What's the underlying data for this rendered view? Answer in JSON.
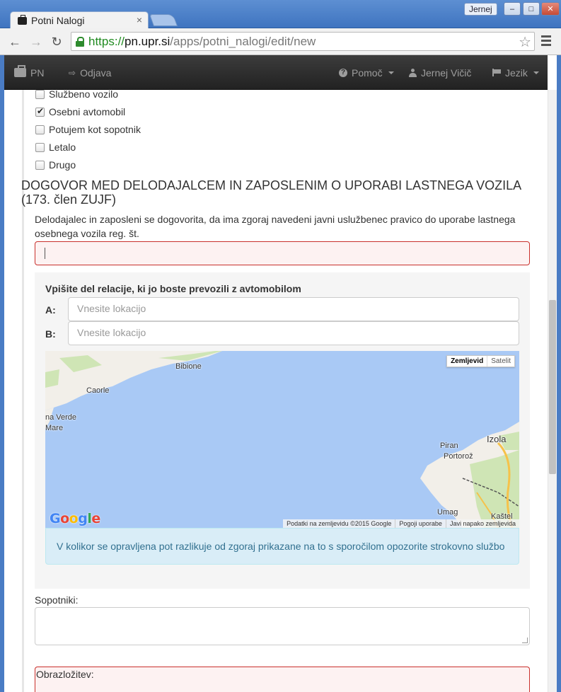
{
  "browser": {
    "tab_title": "Potni Nalogi",
    "tab_close": "×",
    "user_name": "Jernej",
    "url_scheme": "https://",
    "url_host": "pn.upr.si",
    "url_path": "/apps/potni_nalogi/edit/new"
  },
  "navbar": {
    "brand": "PN",
    "logout": "Odjava",
    "help": "Pomoč",
    "user": "Jernej Vičič",
    "language": "Jezik"
  },
  "transport_options": [
    {
      "label": "Službeno vozilo",
      "checked": false
    },
    {
      "label": "Osebni avtomobil",
      "checked": true
    },
    {
      "label": "Potujem kot sopotnik",
      "checked": false
    },
    {
      "label": "Letalo",
      "checked": false
    },
    {
      "label": "Drugo",
      "checked": false
    }
  ],
  "agreement": {
    "title": "DOGOVOR MED DELODAJALCEM IN ZAPOSLENIM O UPORABI LASTNEGA VOZILA (173. člen ZUJF)",
    "text": "Delodajalec in zaposleni se dogovorita, da ima zgoraj navedeni javni uslužbenec pravico do uporabe lastnega osebnega vozila reg. št.",
    "reg_value": ""
  },
  "route": {
    "title": "Vpišite del relacije, ki jo boste prevozili z avtomobilom",
    "label_a": "A:",
    "label_b": "B:",
    "placeholder": "Vnesite lokacijo"
  },
  "map": {
    "type_map": "Zemljevid",
    "type_satellite": "Satelit",
    "places": [
      "Bibione",
      "Caorle",
      "na Verde",
      "Mare",
      "Izola",
      "Piran",
      "Portorož",
      "Umag",
      "Kaštel"
    ],
    "google": "Google",
    "attribution": [
      "Podatki na zemljevidu ©2015 Google",
      "Pogoji uporabe",
      "Javi napako zemljevida"
    ],
    "colors": {
      "sea": "#a9c9f5",
      "land": "#f2efe9",
      "green": "#cfe5b5"
    }
  },
  "info_alert": "V kolikor se opravljena pot razlikuje od zgoraj prikazane na to s sporočilom opozorite strokovno službo",
  "sopotniki_label": "Sopotniki:",
  "obrazlozitev_label": "Obrazložitev:"
}
